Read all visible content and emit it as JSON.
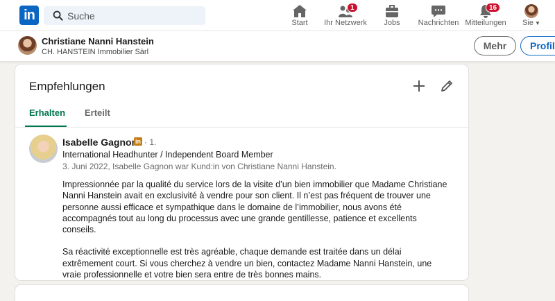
{
  "nav": {
    "logo_text": "in",
    "search_placeholder": "Suche",
    "items": [
      {
        "label": "Start",
        "icon": "home-icon"
      },
      {
        "label": "Ihr Netzwerk",
        "icon": "network-icon",
        "badge": "1"
      },
      {
        "label": "Jobs",
        "icon": "briefcase-icon"
      },
      {
        "label": "Nachrichten",
        "icon": "messaging-icon"
      },
      {
        "label": "Mitteilungen",
        "icon": "bell-icon",
        "badge": "16"
      },
      {
        "label": "Sie",
        "icon": "me-avatar"
      }
    ]
  },
  "profile_bar": {
    "name": "Christiane Nanni Hanstein",
    "company": "CH. HANSTEIN Immobilier Sàrl",
    "more_label": "Mehr",
    "profile_label": "Profil"
  },
  "recommendations": {
    "title": "Empfehlungen",
    "tabs": [
      {
        "label": "Erhalten",
        "active": true
      },
      {
        "label": "Erteilt",
        "active": false
      }
    ],
    "items": [
      {
        "name": "Isabelle Gagnon",
        "badge": "in",
        "degree": "· 1.",
        "headline": "International Headhunter / Independent Board Member",
        "meta": "3. Juni 2022, Isabelle Gagnon war Kund:in von Christiane Nanni Hanstein.",
        "paragraph1": "Impressionnée par la qualité du service lors de la visite d’un bien immobilier que Madame Christiane Nanni Hanstein avait en exclusivité à vendre pour son client. Il n’est pas fréquent de trouver une personne aussi efficace et sympathique dans le domaine de l’immobilier, nous avons été accompagnés tout au long du processus avec une grande gentillesse, patience et excellents conseils.",
        "paragraph2": "Sa réactivité exceptionnelle est très agréable, chaque demande est traitée dans un délai extrêmement court. Si vous cherchez à vendre un bien, contactez Madame Nanni Hanstein, une vraie professionnelle et votre bien sera entre de très bonnes mains."
      }
    ]
  },
  "colors": {
    "brand": "#0a66c2",
    "tab_active": "#01754f",
    "badge": "#cb112d",
    "background": "#f4f2ee"
  }
}
